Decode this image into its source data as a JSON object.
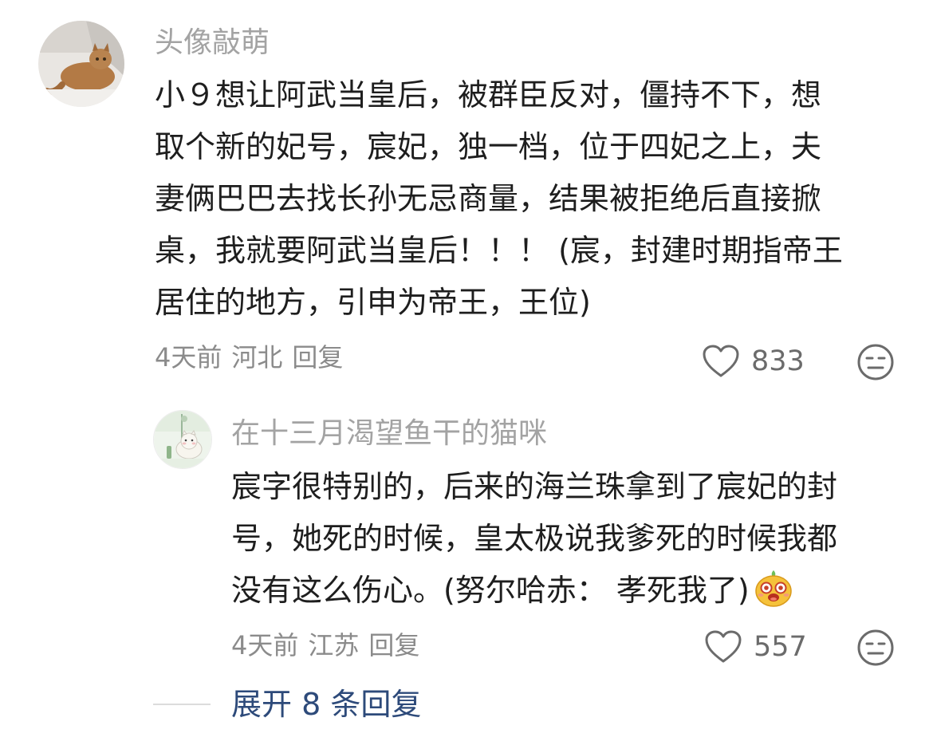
{
  "comment": {
    "username": "头像敲萌",
    "avatar_icon": "cat-photo-avatar",
    "lines": [
      "小９想让阿武当皇后，被群臣反对，僵持不下，想",
      "取个新的妃号，宸妃，独一档，位于四妃之上，夫",
      "妻俩巴巴去找长孙无忌商量，结果被拒绝后直接掀",
      "桌，我就要阿武当皇后！！！ (宸，封建时期指帝王",
      "居住的地方，引申为帝王，王位)"
    ],
    "time": "4天前",
    "location": "河北",
    "reply_label": "回复",
    "likes": "833"
  },
  "reply": {
    "username": "在十三月渴望鱼干的猫咪",
    "avatar_icon": "illustrated-cat-avatar",
    "lines": [
      "宸字很特别的，后来的海兰珠拿到了宸妃的封",
      "号，她死的时候，皇太极说我爹死的时候我都",
      "没有这么伤心。(努尔哈赤： 孝死我了)"
    ],
    "emoji": "laughing-emoji",
    "time": "4天前",
    "location": "江苏",
    "reply_label": "回复",
    "likes": "557"
  },
  "expand_label": "展开 8 条回复",
  "colors": {
    "username": "#a3a3a3",
    "text": "#1e1e1e",
    "meta": "#8b8b8b",
    "expand": "#2d4a7a"
  }
}
